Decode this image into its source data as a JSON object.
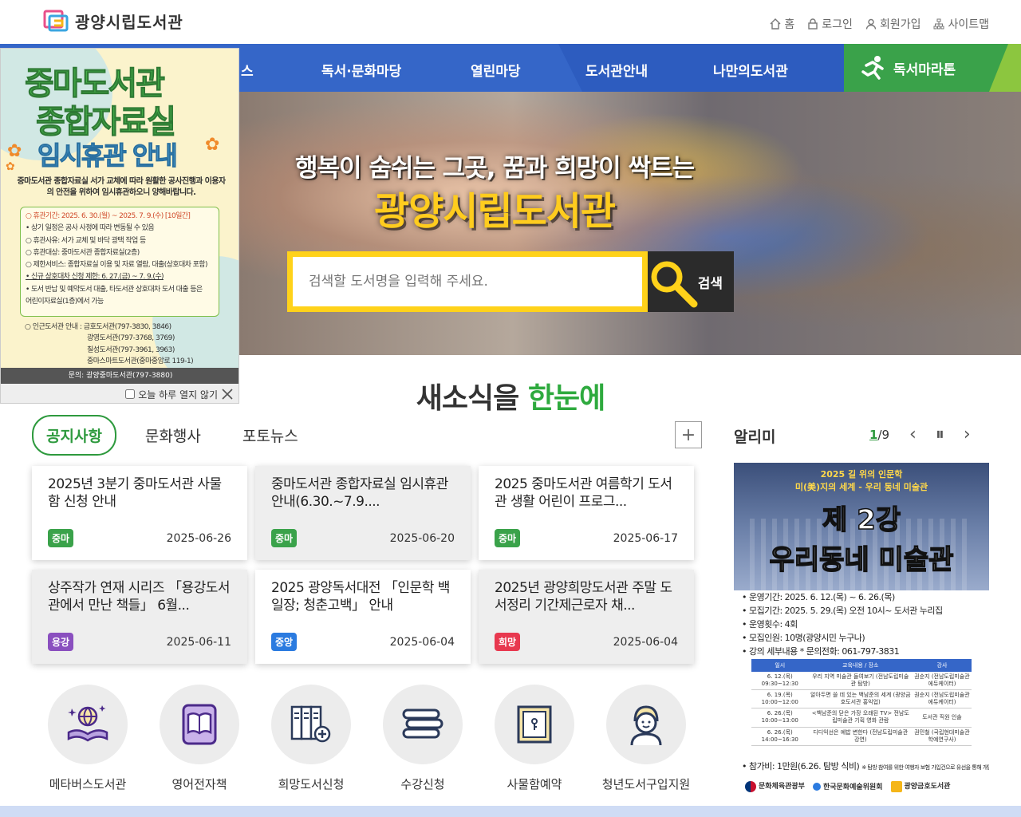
{
  "header": {
    "site_name": "광양시립도서관",
    "util_links": [
      {
        "label": "홈",
        "icon": "home-icon"
      },
      {
        "label": "로그인",
        "icon": "lock-icon"
      },
      {
        "label": "회원가입",
        "icon": "user-icon"
      },
      {
        "label": "사이트맵",
        "icon": "sitemap-icon"
      }
    ]
  },
  "nav": {
    "items": [
      "스",
      "독서·문화마당",
      "열린마당",
      "도서관안내",
      "나만의도서관"
    ],
    "marathon": "독서마라톤"
  },
  "hero": {
    "subtitle": "행복이 숨쉬는 그곳, 꿈과 희망이 싹트는",
    "title": "광양시립도서관",
    "search_placeholder": "검색할 도서명을 입력해 주세요.",
    "search_button": "검색"
  },
  "popup": {
    "heading1": "중마도서관",
    "heading2": "종합자료실",
    "heading3": "임시휴관 안내",
    "note": "중마도서관 종합자료실 서가 교체에 따라 원활한 공사진행과 이용자의 안전을 위하여 임시휴관하오니 양해바랍니다.",
    "lines": [
      "○ 휴관기간: 2025. 6. 30.(월) ~ 2025. 7. 9.(수) [10일간]",
      "• 상기 일정은 공사 사정에 따라 변동될 수 있음",
      "○ 휴관사유: 서가 교체 및 바닥 광택 작업 등",
      "○ 휴관대상: 중마도서관 종합자료실(2층)",
      "○ 제한서비스: 종합자료실 이용 및 자료 열람, 대출(상호대차 포함)",
      "• 신규 상호대차 신청 제한: 6. 27.(금) ~ 7. 9.(수)",
      "• 도서 반납 및 예약도서 대출, 타도서관 상호대차 도서 대출 등은",
      "어린이자료실(1층)에서 가능"
    ],
    "other_libs": [
      "○ 인근도서관 안내 : 금호도서관(797-3830, 3846)",
      "광영도서관(797-3768, 3769)",
      "칠성도서관(797-3961, 3963)",
      "중마스마트도서관(중마중앙로 119-1)"
    ],
    "contact": "문의: 광양중마도서관(797-3880)",
    "close_today": "오늘 하루 열지 않기"
  },
  "news": {
    "section_title_a": "새소식을",
    "section_title_b": "한눈에",
    "tabs": [
      "공지사항",
      "문화행사",
      "포토뉴스"
    ],
    "cards": [
      {
        "title": "2025년 3분기 중마도서관 사물함 신청 안내",
        "badge": "중마",
        "color": "#3aa24a",
        "date": "2025-06-26"
      },
      {
        "title": "중마도서관 종합자료실 임시휴관 안내(6.30.~7.9....",
        "badge": "중마",
        "color": "#3aa24a",
        "date": "2025-06-20"
      },
      {
        "title": "2025 중마도서관 여름학기 도서관 생활 어린이 프로그...",
        "badge": "중마",
        "color": "#3aa24a",
        "date": "2025-06-17"
      },
      {
        "title": "상주작가 연재 시리즈 「용강도서관에서 만난 책들」 6월...",
        "badge": "용강",
        "color": "#8a4fbf",
        "date": "2025-06-11"
      },
      {
        "title": "2025 광양독서대전 「인문학 백일장; 청춘고백」 안내",
        "badge": "중앙",
        "color": "#2b7be0",
        "date": "2025-06-04"
      },
      {
        "title": "2025년 광양희망도서관 주말 도서정리 기간제근로자 채...",
        "badge": "희망",
        "color": "#e8384f",
        "date": "2025-06-04"
      }
    ]
  },
  "alrimi": {
    "title": "알리미",
    "current": "1",
    "total": "/9",
    "poster": {
      "line1": "2025 길 위의 인문학",
      "line2": "미(美)지의 세계 - 우리 동네 미술관",
      "line3": "제 2강",
      "line4": "우리동네 미술관",
      "info": [
        "• 운영기간: 2025. 6. 12.(목) ~ 6. 26.(목)",
        "• 모집기간: 2025. 5. 29.(목) 오전 10시~ 도서관 누리집",
        "• 운영횟수: 4회",
        "• 모집인원: 10명(광양시민 누구나)",
        "• 강의 세부내용          * 문의전화: 061-797-3831"
      ],
      "table_head": [
        "일시",
        "교육내용 / 장소",
        "강사"
      ],
      "table_rows": [
        [
          "6. 12.(목) 09:30~12:30",
          "우리 지역 미술관 들여보기 (전남도립미술관 탐방)",
          "권순지 (전남도립미술관 에듀케이터)"
        ],
        [
          "6. 19.(목) 10:00~12:00",
          "알아두면 쓸 데 있는 백남준의 세계 (광양금호도서관 홍익업)",
          "권순지 (전남도립미술관 에듀케이터)"
        ],
        [
          "6. 26.(목) 10:00~13:00",
          "<백남준의 닫은 가장 오래된 TV> 전남도립미술관 기획 영화 관람",
          "도서관 직원 인솔"
        ],
        [
          "6. 26.(목) 14:00~16:30",
          "디디익선은 예밥 변한다 (전남도립미술관 강연)",
          "권민철 (국립현대미술관 학예연구사)"
        ]
      ],
      "fee": "• 참가비: 1만원(6.26. 탐방 식비)",
      "fee_note": "※ 탐방 참여를 위한 여행자 보험 가입건으로 유선을 통해 개인정보를 확인할 수 있습니다.",
      "orgs": [
        "문화체육관광부",
        "한국문화예술위원회",
        "광양금호도서관"
      ]
    }
  },
  "quick_links": [
    {
      "label": "메타버스도서관",
      "icon": "metaverse-book-icon"
    },
    {
      "label": "영어전자책",
      "icon": "ebook-icon"
    },
    {
      "label": "희망도서신청",
      "icon": "book-request-icon"
    },
    {
      "label": "수강신청",
      "icon": "books-stack-icon"
    },
    {
      "label": "사물함예약",
      "icon": "locker-icon"
    },
    {
      "label": "청년도서구입지원",
      "icon": "youth-icon"
    }
  ],
  "colors": {
    "nav_blue": "#3566c8",
    "marathon_green": "#3aa24a",
    "accent_yellow": "#ffd21a",
    "title_green": "#2eaa3e"
  }
}
